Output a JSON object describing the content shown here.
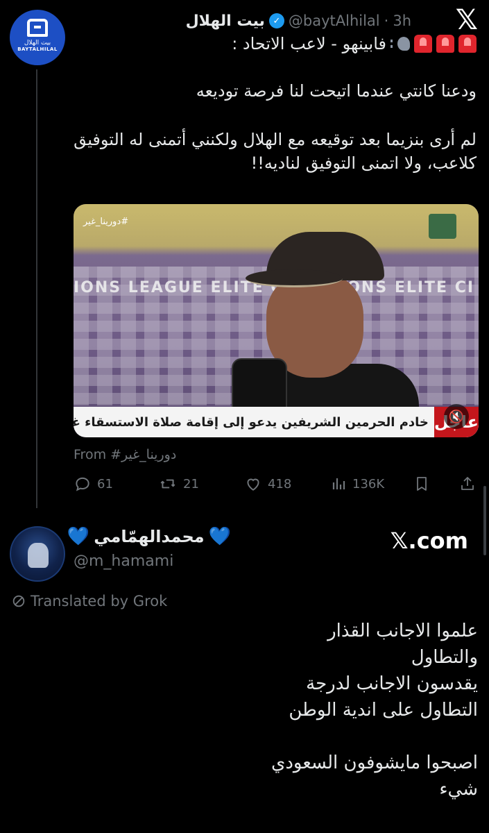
{
  "tweet1": {
    "author_name": "بيت الهلال",
    "handle": "@baytAlhilal",
    "separator": "·",
    "time": "3h",
    "avatar_text_ar": "بيت الهلال",
    "avatar_text_en": "BAYTALHILAL",
    "line1_text": "فابينهو - لاعب الاتحاد :",
    "para2": "ودعنا كانتي عندما اتيحت لنا فرصة توديعه",
    "para3_line1": "لم أرى بنزيما بعد توقيعه مع الهلال ولكنني أتمنى له التوفيق",
    "para3_line2": "كلاعب، ولا اتمنى التوفيق لناديه!!",
    "media": {
      "hashtag_overlay": "#دورينا_غير",
      "ticker": "خادم الحرمين الشريفين يدعو إلى إقامة صلاة الاستسقاء غدا الخميس",
      "urgent_label": "عاجل",
      "board_text": "IONS LEAGUE ELITE  CHAMPIONS       ELITE  CI"
    },
    "from_label": "From",
    "from_source": "#دورينا_غير",
    "actions": {
      "replies": "61",
      "retweets": "21",
      "likes": "418",
      "views": "136K"
    }
  },
  "tweet2": {
    "author_name": "محمدالهمّامي",
    "heart": "💙",
    "handle": "@m_hamami",
    "site": "𝕏.com",
    "translated_label": "Translated by Grok",
    "lines": [
      "علموا الاجانب القذار",
      "والتطاول",
      "يقدسون الاجانب لدرجة",
      "التطاول على اندية الوطن",
      "",
      "اصبحوا مايشوفون السعودي",
      "شيء"
    ]
  },
  "brand": {
    "x_logo": "𝕏"
  },
  "colors": {
    "background": "#000000",
    "text": "#e7e9ea",
    "muted": "#71767b",
    "verified": "#1d9bf0",
    "urgent": "#c4161c"
  }
}
